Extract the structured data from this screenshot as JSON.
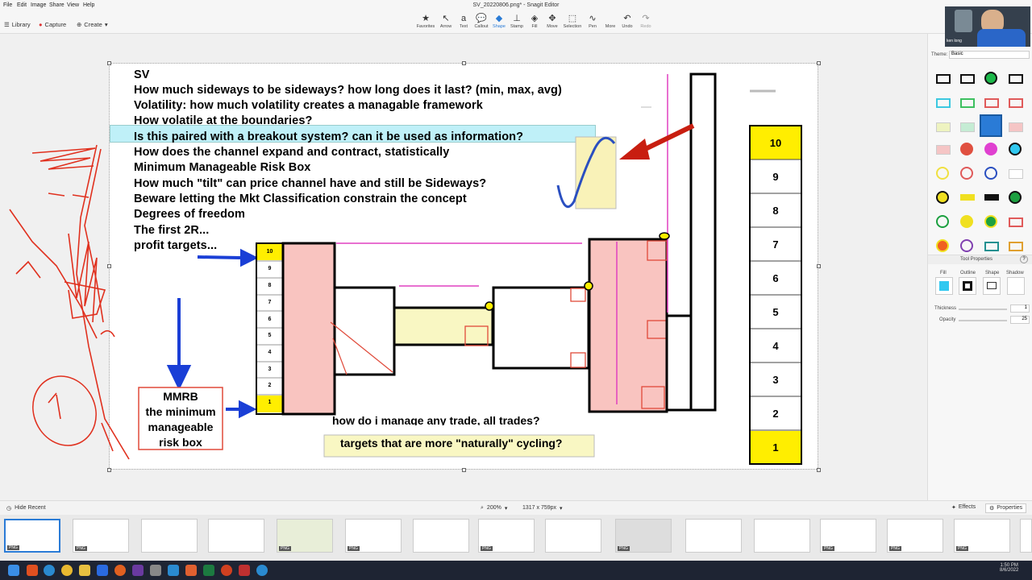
{
  "menu": [
    "File",
    "Edit",
    "Image",
    "Share",
    "View",
    "Help"
  ],
  "window_title": "SV_20220806.png* - Snagit Editor",
  "toolbar": {
    "library": "Library",
    "capture": "Capture",
    "create": "Create",
    "tools": [
      "Favorites",
      "Arrow",
      "Text",
      "Callout",
      "Shape",
      "Stamp",
      "Fill",
      "Move",
      "Selection",
      "Pen",
      "More",
      "Undo",
      "Redo"
    ]
  },
  "doc": {
    "questions": [
      "SV",
      "How much sideways to be sideways? how long does it last? (min, max, avg)",
      "Volatility: how much volatility creates a managable framework",
      "How volatile at the  boundaries?",
      "Is this paired with a breakout system? can it be used  as information?",
      "How does the channel expand and contract, statistically",
      "Minimum Manageable Risk Box",
      "How much \"tilt\" can price channel have and still be Sideways?",
      "Beware letting the Mkt Classification constrain the concept",
      "Degrees of freedom",
      "The first 2R...",
      "profit targets..."
    ],
    "mmrb_lines": [
      "MMRB",
      "the minimum",
      "manageable",
      "risk box"
    ],
    "bottom_text_1": "how do i manage any trade, all trades?",
    "bottom_text_2": "targets that are more \"naturally\" cycling?",
    "small_scale": [
      "10",
      "9",
      "8",
      "7",
      "6",
      "5",
      "4",
      "3",
      "2",
      "1"
    ],
    "big_scale": [
      "10",
      "9",
      "8",
      "7",
      "6",
      "5",
      "4",
      "3",
      "2",
      "1"
    ]
  },
  "panel": {
    "theme_label": "Theme:",
    "theme_value": "Basic",
    "tool_properties": "Tool Properties",
    "help": "?",
    "prop_headers": [
      "Fill",
      "Outline",
      "Shape",
      "Shadow"
    ],
    "thickness_label": "Thickness",
    "thickness_value": "1",
    "opacity_label": "Opacity",
    "opacity_value": "25"
  },
  "status": {
    "hide_recent": "Hide Recent",
    "zoom": "200%",
    "dimensions": "1317 x 759px",
    "effects": "Effects",
    "properties": "Properties"
  },
  "tray": {
    "tag": "PNG"
  },
  "taskbar": {
    "time": "1:50 PM",
    "date": "8/6/2022"
  },
  "webcam": {
    "name": "ken long"
  },
  "colors": {
    "accent": "#2a7bd6",
    "yellow": "#ffee00",
    "salmon": "#f9c4c0",
    "cyan": "#bff0f8"
  }
}
